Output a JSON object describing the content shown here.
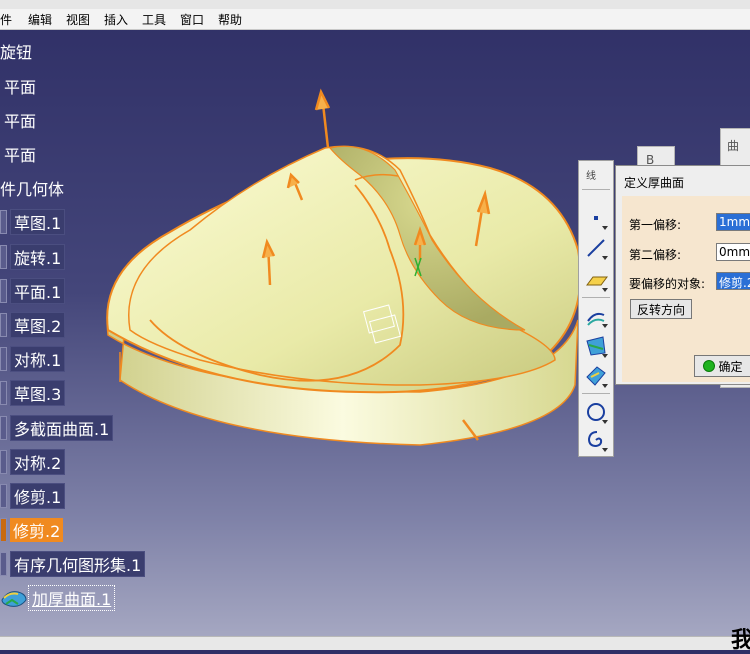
{
  "menu": {
    "items": [
      "件",
      "编辑",
      "视图",
      "插入",
      "工具",
      "窗口",
      "帮助"
    ]
  },
  "tree": {
    "items": [
      {
        "label": "旋钮",
        "style": "plain",
        "icon": "none"
      },
      {
        "label": "平面",
        "style": "plain",
        "icon": "plane-icon"
      },
      {
        "label": "平面",
        "style": "plain",
        "icon": "plane-icon"
      },
      {
        "label": "平面",
        "style": "plain",
        "icon": "plane-icon"
      },
      {
        "label": "件几何体",
        "style": "plain",
        "icon": "none"
      },
      {
        "label": "草图.1",
        "style": "boxed",
        "icon": "sketch-icon"
      },
      {
        "label": "旋转.1",
        "style": "boxed",
        "icon": "revolve-icon"
      },
      {
        "label": "平面.1",
        "style": "boxed",
        "icon": "plane-icon"
      },
      {
        "label": "草图.2",
        "style": "boxed",
        "icon": "sketch-icon"
      },
      {
        "label": "对称.1",
        "style": "boxed",
        "icon": "symmetry-icon"
      },
      {
        "label": "草图.3",
        "style": "boxed",
        "icon": "sketch-icon"
      },
      {
        "label": "多截面曲面.1",
        "style": "boxed",
        "icon": "multi-section-icon"
      },
      {
        "label": "对称.2",
        "style": "boxed",
        "icon": "symmetry-icon"
      },
      {
        "label": "修剪.1",
        "style": "boxed",
        "icon": "trim-icon"
      },
      {
        "label": "修剪.2",
        "style": "selected",
        "icon": "trim-icon"
      },
      {
        "label": "有序几何图形集.1",
        "style": "boxed",
        "icon": "geometric-set-icon"
      },
      {
        "label": "加厚曲面.1",
        "style": "underlined",
        "icon": "thick-surface-icon"
      }
    ]
  },
  "toolbar": {
    "title": "线",
    "buttons": [
      "point-icon",
      "line-icon",
      "plane-icon",
      "extrude-surface-icon",
      "sweep-surface-icon",
      "fill-surface-icon",
      "circle-icon",
      "spiral-icon"
    ]
  },
  "bg_panels": {
    "letter_a": "B",
    "letter_b": "曲"
  },
  "dialog": {
    "title": "定义厚曲面",
    "first_offset_label": "第一偏移:",
    "first_offset_value": "1mm",
    "second_offset_label": "第二偏移:",
    "second_offset_value": "0mm",
    "object_label": "要偏移的对象:",
    "object_value": "修剪.2",
    "reverse_button": "反转方向",
    "ok_button": "确定"
  },
  "corner_text": "我",
  "colors": {
    "model_fill": "#e9eaa8",
    "model_edge": "#f08a20",
    "selection": "#f08a20"
  }
}
